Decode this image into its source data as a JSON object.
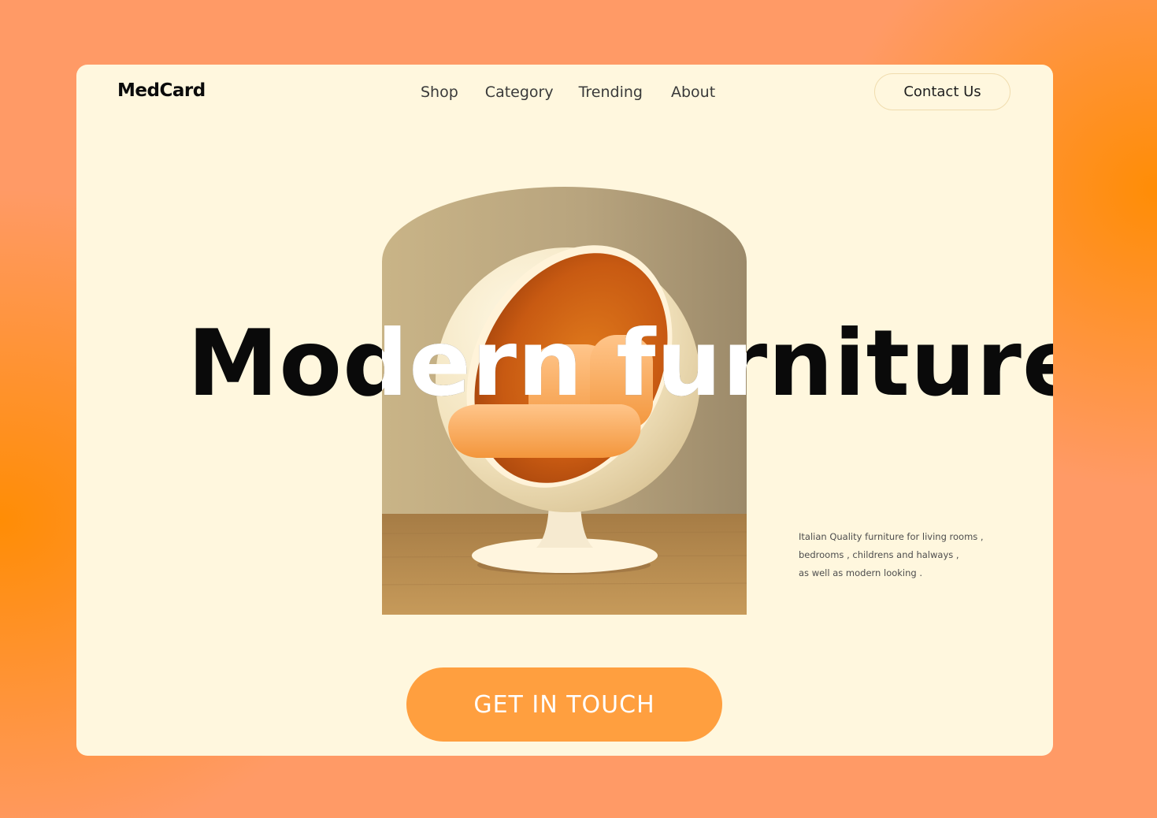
{
  "brand": {
    "name": "MedCard"
  },
  "nav": {
    "items": [
      {
        "label": "Shop"
      },
      {
        "label": "Category"
      },
      {
        "label": "Trending"
      },
      {
        "label": "About"
      }
    ]
  },
  "header": {
    "contact_label": "Contact Us"
  },
  "hero": {
    "title": "Modern furniture",
    "image_description_icon": "ball-chair-photo",
    "description_lines": [
      "Italian Quality furniture for living rooms ,",
      "bedrooms , childrens and halways ,",
      "as well as modern looking ."
    ],
    "cta_label": "GET IN TOUCH"
  },
  "colors": {
    "page_background": "#ff9a66",
    "accent_orange": "#ff8c00",
    "card_background": "#fff7de",
    "cta_background": "#ff9f3f",
    "text_dark": "#0a0a0a"
  }
}
